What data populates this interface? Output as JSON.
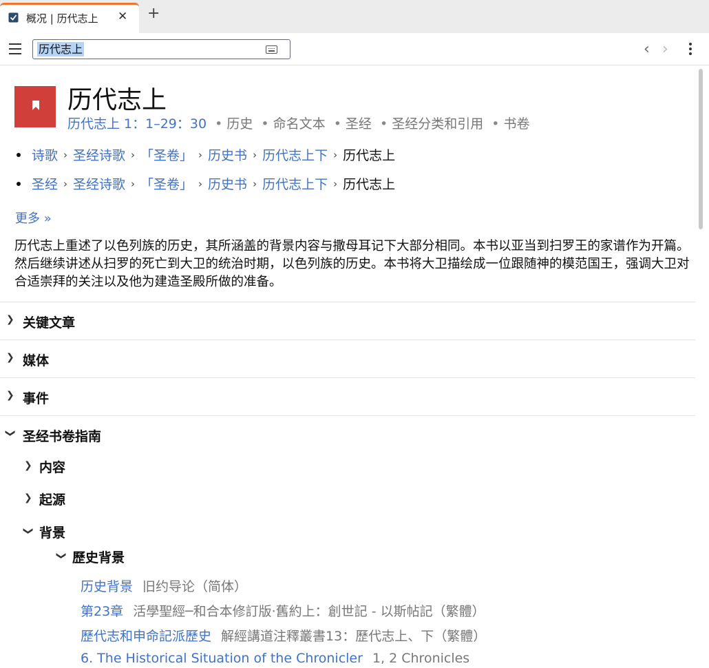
{
  "tab": {
    "title": "概况 | 历代志上",
    "close": "✕",
    "add": "+"
  },
  "search": {
    "value": "历代志上"
  },
  "nav": {
    "back": "‹",
    "forward": "›"
  },
  "header": {
    "title": "历代志上",
    "ref": "历代志上 1：1–29：30",
    "tags": [
      "历史",
      "命名文本",
      "圣经",
      "圣经分类和引用",
      "书卷"
    ]
  },
  "breadcrumbs": [
    {
      "items": [
        "诗歌",
        "圣经诗歌",
        "「圣卷」",
        "历史书",
        "历代志上下"
      ],
      "current": "历代志上"
    },
    {
      "items": [
        "圣经",
        "圣经诗歌",
        "「圣卷」",
        "历史书",
        "历代志上下"
      ],
      "current": "历代志上"
    }
  ],
  "more_link": "更多 »",
  "description": "历代志上重述了以色列族的历史，其所涵盖的背景内容与撒母耳记下大部分相同。本书以亚当到扫罗王的家谱作为开篇。然后继续讲述从扫罗的死亡到大卫的统治时期，以色列族的历史。本书将大卫描绘成一位跟随神的模范国王，强调大卫对合适崇拜的关注以及他为建造圣殿所做的准备。",
  "sections": [
    {
      "label": "关键文章",
      "expanded": false
    },
    {
      "label": "媒体",
      "expanded": false
    },
    {
      "label": "事件",
      "expanded": false
    },
    {
      "label": "圣经书卷指南",
      "expanded": true
    }
  ],
  "guide": {
    "subsections": [
      {
        "label": "内容",
        "expanded": false
      },
      {
        "label": "起源",
        "expanded": false
      },
      {
        "label": "背景",
        "expanded": true
      }
    ],
    "nested": {
      "label": "歷史背景",
      "expanded": true
    },
    "results": [
      {
        "title": "历史背景",
        "source": "旧约导论（简体）"
      },
      {
        "title": "第23章",
        "source": "活學聖經─和合本修訂版·舊約上：創世記 - 以斯帖記（繁體）"
      },
      {
        "title": "歷代志和申命記派歷史",
        "source": "解經講道注釋叢書13：歷代志上、下（繁體）"
      },
      {
        "title": "6. The Historical Situation of the Chronicler",
        "source": "1, 2 Chronicles"
      }
    ]
  },
  "colors": {
    "accent": "#f0742a",
    "link": "#3f72c8",
    "book_icon": "#d13f3b",
    "selection": "#b5d3f5"
  },
  "icons": {
    "tab": "checklist-icon",
    "menu": "hamburger-menu-icon",
    "keyboard": "keyboard-icon",
    "more": "vertical-dots-icon",
    "book": "bookmark-icon",
    "chevron_right": "chevron-right-icon",
    "chevron_down": "chevron-down-icon"
  }
}
